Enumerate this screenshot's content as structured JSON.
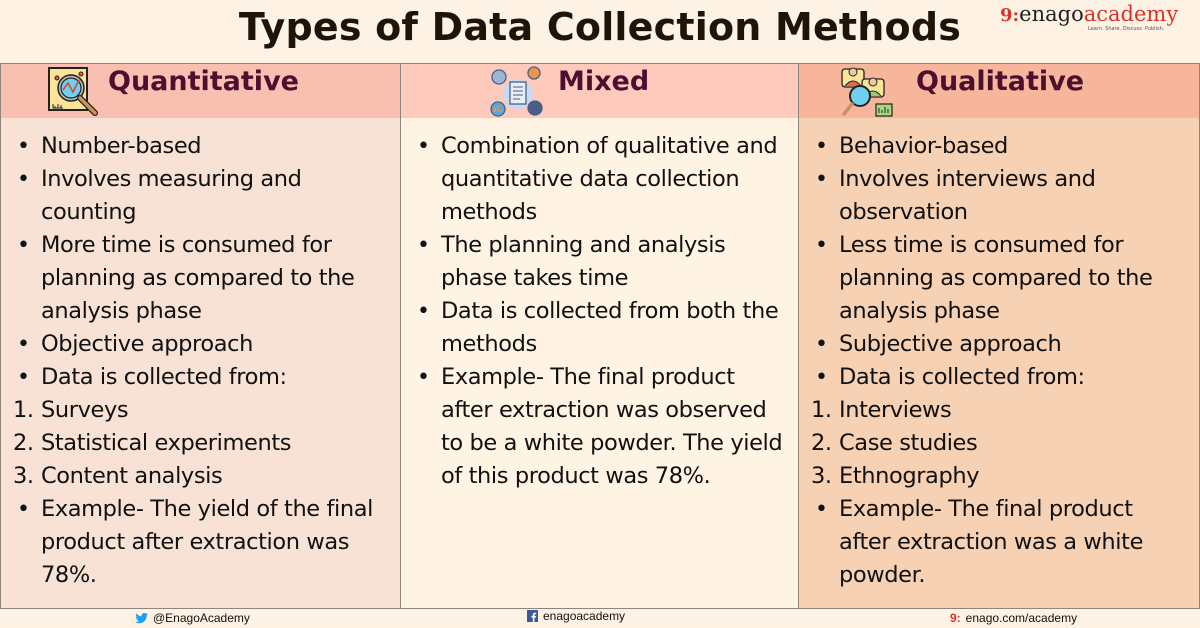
{
  "title": "Types of Data Collection Methods",
  "logo": {
    "mark": "9:",
    "enago": "enago",
    "academy": "academy",
    "tagline": "Learn. Share. Discuss. Publish."
  },
  "columns": [
    {
      "id": "quantitative",
      "label": "Quantitative",
      "icon": "magnifier-chart-icon",
      "items": [
        {
          "type": "bullet",
          "text": "Number-based"
        },
        {
          "type": "bullet",
          "text": "Involves measuring and counting"
        },
        {
          "type": "bullet",
          "text": "More time is consumed for planning as compared to the analysis phase"
        },
        {
          "type": "bullet",
          "text": "Objective approach"
        },
        {
          "type": "bullet",
          "text": "Data is collected from:"
        },
        {
          "type": "num",
          "n": "1.",
          "text": "Surveys"
        },
        {
          "type": "num",
          "n": "2.",
          "text": "Statistical experiments"
        },
        {
          "type": "num",
          "n": "3.",
          "text": "Content analysis"
        },
        {
          "type": "bullet",
          "text": "Example- The yield of the final product after extraction was 78%."
        }
      ]
    },
    {
      "id": "mixed",
      "label": "Mixed",
      "icon": "document-network-icon",
      "items": [
        {
          "type": "bullet",
          "text": "Combination of qualitative and quantitative data collection methods"
        },
        {
          "type": "bullet",
          "text": "The planning and analysis phase takes time"
        },
        {
          "type": "bullet",
          "text": "Data is collected from both the methods"
        },
        {
          "type": "bullet",
          "text": "Example- The final product after extraction was observed to be a white powder. The yield of this product was 78%."
        }
      ]
    },
    {
      "id": "qualitative",
      "label": "Qualitative",
      "icon": "people-magnifier-icon",
      "items": [
        {
          "type": "bullet",
          "text": "Behavior-based"
        },
        {
          "type": "bullet",
          "text": "Involves interviews and observation"
        },
        {
          "type": "bullet",
          "text": "Less time is consumed for planning as compared to the analysis phase"
        },
        {
          "type": "bullet",
          "text": "Subjective approach"
        },
        {
          "type": "bullet",
          "text": "Data is collected from:"
        },
        {
          "type": "num",
          "n": "1.",
          "text": "Interviews"
        },
        {
          "type": "num",
          "n": "2.",
          "text": "Case studies"
        },
        {
          "type": "num",
          "n": "3.",
          "text": "Ethnography"
        },
        {
          "type": "bullet",
          "text": "Example- The final product after extraction was a white powder."
        }
      ]
    }
  ],
  "footer": {
    "twitter": "@EnagoAcademy",
    "facebook": "enagoacademy",
    "website": "enago.com/academy",
    "website_mark": "9:"
  },
  "colors": {
    "title": "#1e1408",
    "heading": "#4d0f2f",
    "brand_red": "#d9342b",
    "background": "#fdf2e3"
  }
}
